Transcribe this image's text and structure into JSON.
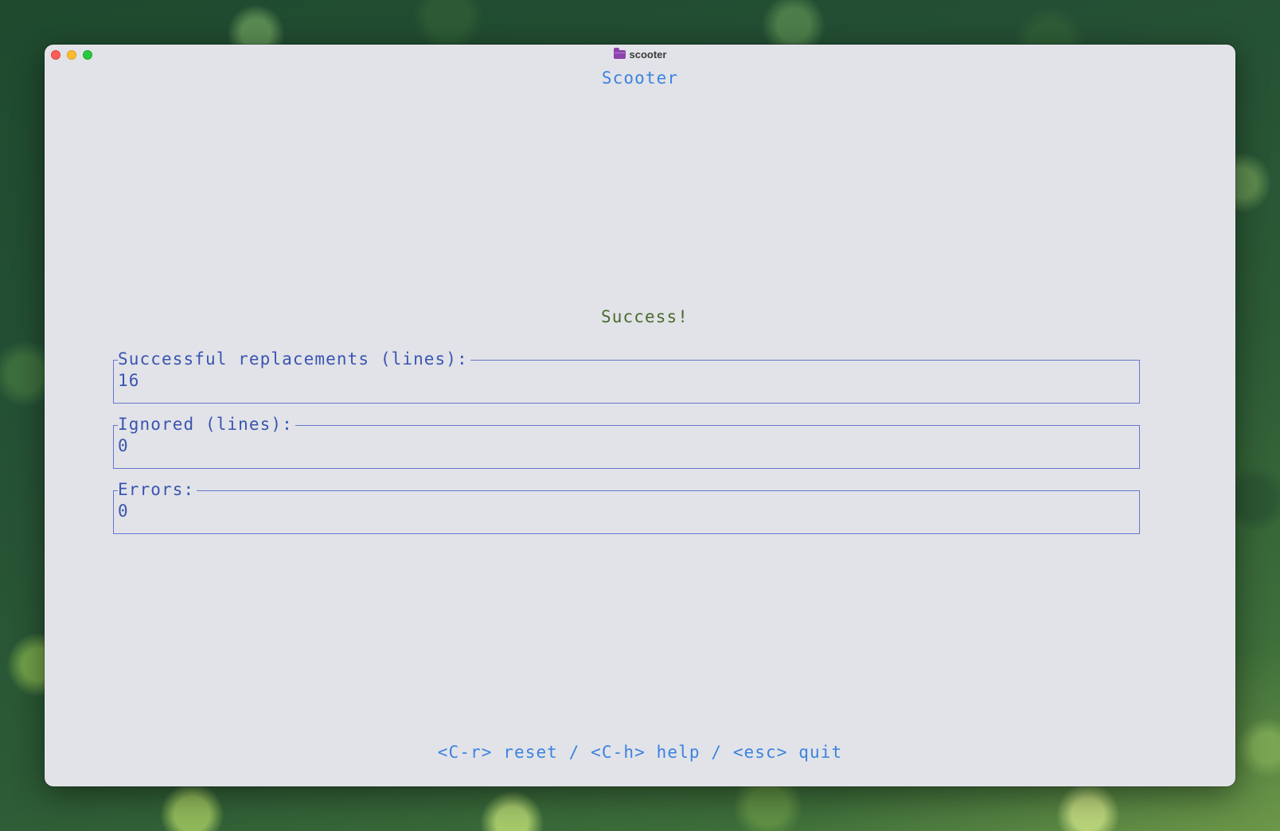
{
  "window": {
    "title": "scooter",
    "icon": "folder-icon"
  },
  "app": {
    "title": "Scooter",
    "status": "Success!"
  },
  "panels": [
    {
      "label": "Successful replacements (lines):",
      "value": "16"
    },
    {
      "label": "Ignored (lines):",
      "value": "0"
    },
    {
      "label": "Errors:",
      "value": "0"
    }
  ],
  "footer": {
    "keybindings": "<C-r> reset / <C-h> help / <esc> quit"
  },
  "colors": {
    "accent": "#3b82e0",
    "success": "#4a6a30",
    "panel_border": "#6677cc",
    "panel_text": "#3a55b0",
    "window_bg": "#e2e3e8"
  }
}
